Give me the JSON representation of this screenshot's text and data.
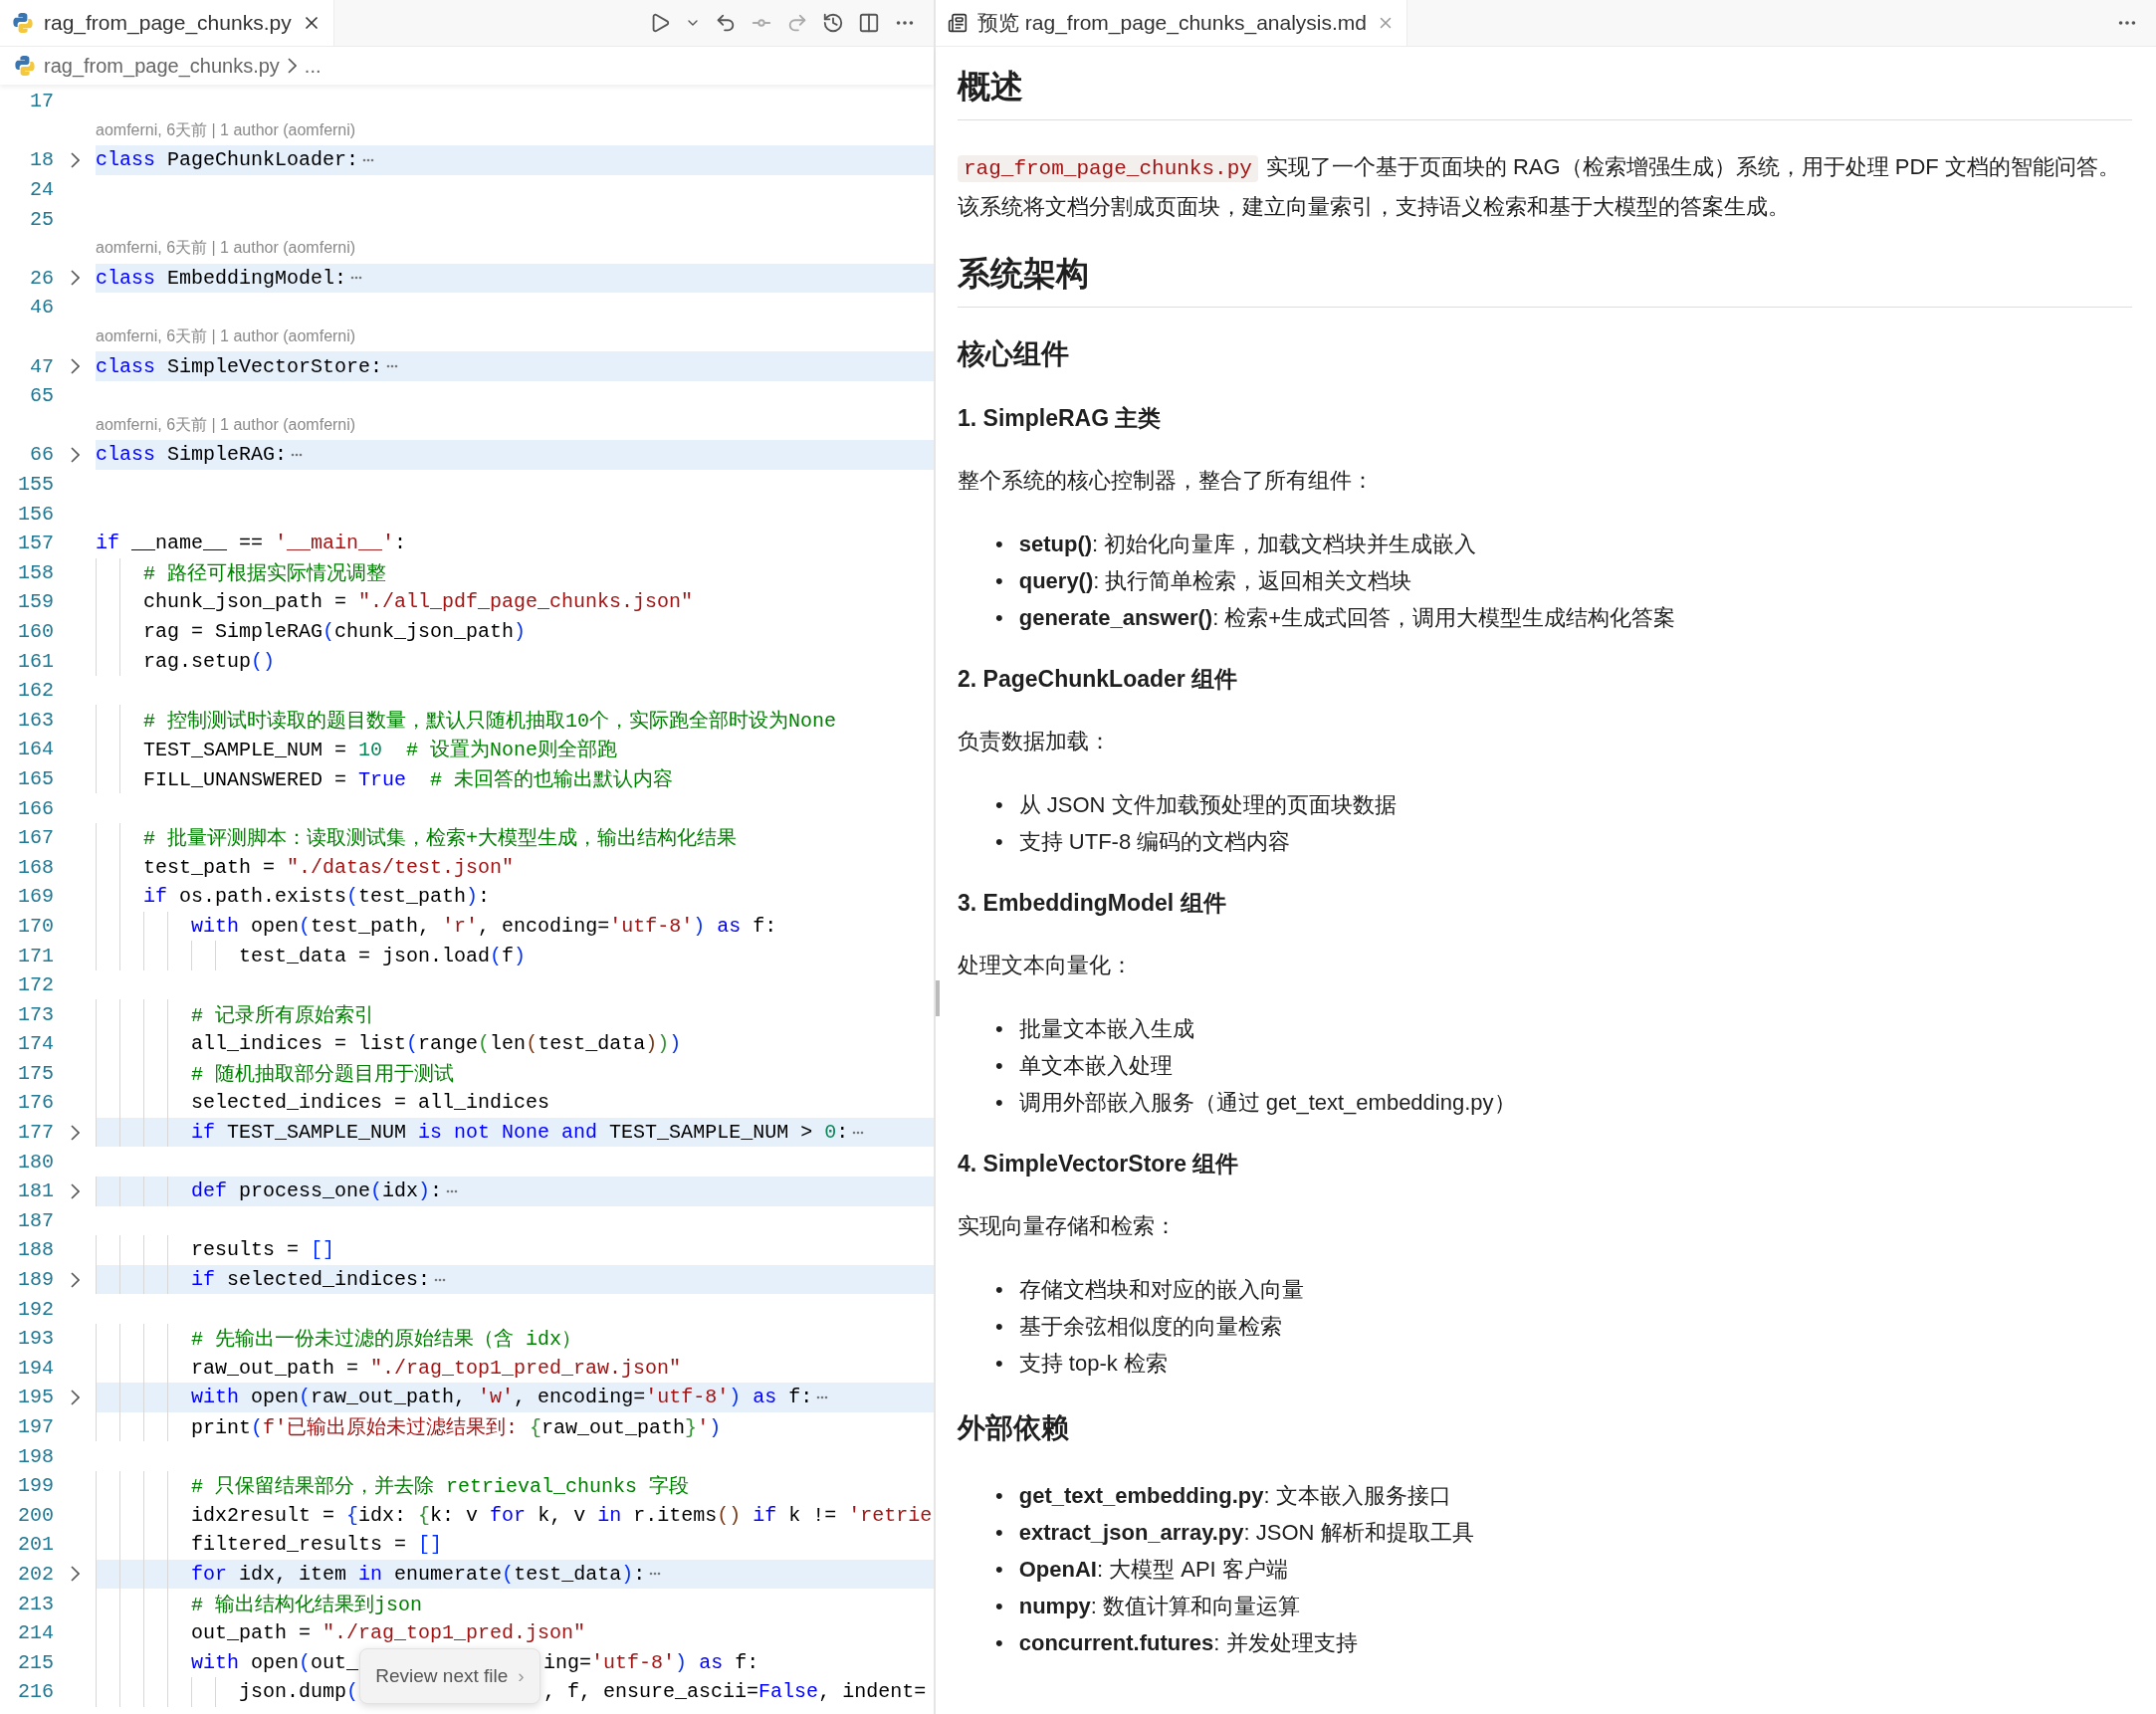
{
  "editor": {
    "tab": {
      "label": "rag_from_page_chunks.py",
      "selected": true
    },
    "breadcrumb": [
      "rag_from_page_chunks.py",
      "..."
    ],
    "lines": [
      {
        "number": "17"
      },
      {
        "kind": "blame",
        "text": "aomferni, 6天前 | 1 author (aomferni)"
      },
      {
        "number": "18",
        "folded": true,
        "code": [
          {
            "kind": "kw",
            "text": "class"
          },
          {
            "kind": "plain",
            "text": " PageChunkLoader:"
          }
        ]
      },
      {
        "number": "24"
      },
      {
        "number": "25"
      },
      {
        "kind": "blame",
        "text": "aomferni, 6天前 | 1 author (aomferni)"
      },
      {
        "number": "26",
        "folded": true,
        "code": [
          {
            "kind": "kw",
            "text": "class"
          },
          {
            "kind": "plain",
            "text": " EmbeddingModel:"
          }
        ]
      },
      {
        "number": "46"
      },
      {
        "kind": "blame",
        "text": "aomferni, 6天前 | 1 author (aomferni)"
      },
      {
        "number": "47",
        "folded": true,
        "code": [
          {
            "kind": "kw",
            "text": "class"
          },
          {
            "kind": "plain",
            "text": " SimpleVectorStore:"
          }
        ]
      },
      {
        "number": "65"
      },
      {
        "kind": "blame",
        "text": "aomferni, 6天前 | 1 author (aomferni)"
      },
      {
        "number": "66",
        "folded": true,
        "code": [
          {
            "kind": "kw",
            "text": "class"
          },
          {
            "kind": "plain",
            "text": " SimpleRAG:"
          }
        ]
      },
      {
        "number": "155"
      },
      {
        "number": "156"
      },
      {
        "number": "157",
        "code": [
          {
            "kind": "kw",
            "text": "if"
          },
          {
            "kind": "plain",
            "text": " __name__ == "
          },
          {
            "kind": "str",
            "text": "'__main__'"
          },
          {
            "kind": "plain",
            "text": ":"
          }
        ]
      },
      {
        "number": "158",
        "code": [
          {
            "kind": "cmt",
            "text": "    # 路径可根据实际情况调整"
          }
        ]
      },
      {
        "number": "159",
        "code": [
          {
            "kind": "plain",
            "text": "    chunk_json_path = "
          },
          {
            "kind": "str",
            "text": "\"./all_pdf_page_chunks.json\""
          }
        ]
      },
      {
        "number": "160",
        "code": [
          {
            "kind": "plain",
            "text": "    rag = SimpleRAG"
          },
          {
            "kind": "p1",
            "text": "("
          },
          {
            "kind": "plain",
            "text": "chunk_json_path"
          },
          {
            "kind": "p1",
            "text": ")"
          }
        ]
      },
      {
        "number": "161",
        "code": [
          {
            "kind": "plain",
            "text": "    rag.setup"
          },
          {
            "kind": "p1",
            "text": "()"
          }
        ]
      },
      {
        "number": "162"
      },
      {
        "number": "163",
        "code": [
          {
            "kind": "cmt",
            "text": "    # 控制测试时读取的题目数量，默认只随机抽取10个，实际跑全部时设为None"
          }
        ]
      },
      {
        "number": "164",
        "code": [
          {
            "kind": "plain",
            "text": "    TEST_SAMPLE_NUM = "
          },
          {
            "kind": "num",
            "text": "10"
          },
          {
            "kind": "cmt",
            "text": "  # 设置为None则全部跑"
          }
        ]
      },
      {
        "number": "165",
        "code": [
          {
            "kind": "plain",
            "text": "    FILL_UNANSWERED = "
          },
          {
            "kind": "kw",
            "text": "True"
          },
          {
            "kind": "cmt",
            "text": "  # 未回答的也输出默认内容"
          }
        ]
      },
      {
        "number": "166"
      },
      {
        "number": "167",
        "code": [
          {
            "kind": "cmt",
            "text": "    # 批量评测脚本：读取测试集，检索+大模型生成，输出结构化结果"
          }
        ]
      },
      {
        "number": "168",
        "code": [
          {
            "kind": "plain",
            "text": "    test_path = "
          },
          {
            "kind": "str",
            "text": "\"./datas/test.json\""
          }
        ]
      },
      {
        "number": "169",
        "code": [
          {
            "kind": "kw",
            "text": "    if"
          },
          {
            "kind": "plain",
            "text": " os.path.exists"
          },
          {
            "kind": "p1",
            "text": "("
          },
          {
            "kind": "plain",
            "text": "test_path"
          },
          {
            "kind": "p1",
            "text": ")"
          },
          {
            "kind": "plain",
            "text": ":"
          }
        ]
      },
      {
        "number": "170",
        "code": [
          {
            "kind": "kw",
            "text": "        with"
          },
          {
            "kind": "plain",
            "text": " open"
          },
          {
            "kind": "p1",
            "text": "("
          },
          {
            "kind": "plain",
            "text": "test_path, "
          },
          {
            "kind": "str",
            "text": "'r'"
          },
          {
            "kind": "plain",
            "text": ", encoding="
          },
          {
            "kind": "str",
            "text": "'utf-8'"
          },
          {
            "kind": "p1",
            "text": ")"
          },
          {
            "kind": "kw",
            "text": " as"
          },
          {
            "kind": "plain",
            "text": " f:"
          }
        ]
      },
      {
        "number": "171",
        "code": [
          {
            "kind": "plain",
            "text": "            test_data = json.load"
          },
          {
            "kind": "p1",
            "text": "("
          },
          {
            "kind": "plain",
            "text": "f"
          },
          {
            "kind": "p1",
            "text": ")"
          }
        ]
      },
      {
        "number": "172"
      },
      {
        "number": "173",
        "code": [
          {
            "kind": "cmt",
            "text": "        # 记录所有原始索引"
          }
        ]
      },
      {
        "number": "174",
        "code": [
          {
            "kind": "plain",
            "text": "        all_indices = list"
          },
          {
            "kind": "p1",
            "text": "("
          },
          {
            "kind": "plain",
            "text": "range"
          },
          {
            "kind": "p2",
            "text": "("
          },
          {
            "kind": "plain",
            "text": "len"
          },
          {
            "kind": "p3",
            "text": "("
          },
          {
            "kind": "plain",
            "text": "test_data"
          },
          {
            "kind": "p3",
            "text": ")"
          },
          {
            "kind": "p2",
            "text": ")"
          },
          {
            "kind": "p1",
            "text": ")"
          }
        ]
      },
      {
        "number": "175",
        "code": [
          {
            "kind": "cmt",
            "text": "        # 随机抽取部分题目用于测试"
          }
        ]
      },
      {
        "number": "176",
        "code": [
          {
            "kind": "plain",
            "text": "        selected_indices = all_indices"
          }
        ]
      },
      {
        "number": "177",
        "folded": true,
        "code": [
          {
            "kind": "kw",
            "text": "        if"
          },
          {
            "kind": "plain",
            "text": " TEST_SAMPLE_NUM "
          },
          {
            "kind": "kw",
            "text": "is not None and"
          },
          {
            "kind": "plain",
            "text": " TEST_SAMPLE_NUM > "
          },
          {
            "kind": "num",
            "text": "0"
          },
          {
            "kind": "plain",
            "text": ":"
          }
        ]
      },
      {
        "number": "180"
      },
      {
        "number": "181",
        "folded": true,
        "code": [
          {
            "kind": "kw",
            "text": "        def"
          },
          {
            "kind": "plain",
            "text": " process_one"
          },
          {
            "kind": "p1",
            "text": "("
          },
          {
            "kind": "plain",
            "text": "idx"
          },
          {
            "kind": "p1",
            "text": ")"
          },
          {
            "kind": "plain",
            "text": ":"
          }
        ]
      },
      {
        "number": "187"
      },
      {
        "number": "188",
        "code": [
          {
            "kind": "plain",
            "text": "        results = "
          },
          {
            "kind": "p1",
            "text": "[]"
          }
        ]
      },
      {
        "number": "189",
        "folded": true,
        "code": [
          {
            "kind": "kw",
            "text": "        if"
          },
          {
            "kind": "plain",
            "text": " selected_indices:"
          }
        ]
      },
      {
        "number": "192"
      },
      {
        "number": "193",
        "code": [
          {
            "kind": "cmt",
            "text": "        # 先输出一份未过滤的原始结果（含 idx）"
          }
        ]
      },
      {
        "number": "194",
        "code": [
          {
            "kind": "plain",
            "text": "        raw_out_path = "
          },
          {
            "kind": "str",
            "text": "\"./rag_top1_pred_raw.json\""
          }
        ]
      },
      {
        "number": "195",
        "folded": true,
        "code": [
          {
            "kind": "kw",
            "text": "        with"
          },
          {
            "kind": "plain",
            "text": " open"
          },
          {
            "kind": "p1",
            "text": "("
          },
          {
            "kind": "plain",
            "text": "raw_out_path, "
          },
          {
            "kind": "str",
            "text": "'w'"
          },
          {
            "kind": "plain",
            "text": ", encoding="
          },
          {
            "kind": "str",
            "text": "'utf-8'"
          },
          {
            "kind": "p1",
            "text": ")"
          },
          {
            "kind": "kw",
            "text": " as"
          },
          {
            "kind": "plain",
            "text": " f:"
          }
        ]
      },
      {
        "number": "197",
        "code": [
          {
            "kind": "plain",
            "text": "        print"
          },
          {
            "kind": "p1",
            "text": "("
          },
          {
            "kind": "str",
            "text": "f'已输出原始未过滤结果到: "
          },
          {
            "kind": "p2",
            "text": "{"
          },
          {
            "kind": "plain",
            "text": "raw_out_path"
          },
          {
            "kind": "p2",
            "text": "}"
          },
          {
            "kind": "str",
            "text": "'"
          },
          {
            "kind": "p1",
            "text": ")"
          }
        ]
      },
      {
        "number": "198"
      },
      {
        "number": "199",
        "code": [
          {
            "kind": "cmt",
            "text": "        # 只保留结果部分，并去除 retrieval_chunks 字段"
          }
        ]
      },
      {
        "number": "200",
        "code": [
          {
            "kind": "plain",
            "text": "        idx2result = "
          },
          {
            "kind": "p1",
            "text": "{"
          },
          {
            "kind": "plain",
            "text": "idx: "
          },
          {
            "kind": "p2",
            "text": "{"
          },
          {
            "kind": "plain",
            "text": "k: v "
          },
          {
            "kind": "kw",
            "text": "for"
          },
          {
            "kind": "plain",
            "text": " k, v "
          },
          {
            "kind": "kw",
            "text": "in"
          },
          {
            "kind": "plain",
            "text": " r.items"
          },
          {
            "kind": "p3",
            "text": "()"
          },
          {
            "kind": "kw",
            "text": " if"
          },
          {
            "kind": "plain",
            "text": " k != "
          },
          {
            "kind": "str",
            "text": "'retrie"
          }
        ]
      },
      {
        "number": "201",
        "code": [
          {
            "kind": "plain",
            "text": "        filtered_results = "
          },
          {
            "kind": "p1",
            "text": "[]"
          }
        ]
      },
      {
        "number": "202",
        "folded": true,
        "code": [
          {
            "kind": "kw",
            "text": "        for"
          },
          {
            "kind": "plain",
            "text": " idx, item "
          },
          {
            "kind": "kw",
            "text": "in"
          },
          {
            "kind": "plain",
            "text": " enumerate"
          },
          {
            "kind": "p1",
            "text": "("
          },
          {
            "kind": "plain",
            "text": "test_data"
          },
          {
            "kind": "p1",
            "text": ")"
          },
          {
            "kind": "plain",
            "text": ":"
          }
        ]
      },
      {
        "number": "213",
        "code": [
          {
            "kind": "cmt",
            "text": "        # 输出结构化结果到json"
          }
        ]
      },
      {
        "number": "214",
        "code": [
          {
            "kind": "plain",
            "text": "        out_path = "
          },
          {
            "kind": "str",
            "text": "\"./rag_top1_pred.json\""
          }
        ]
      },
      {
        "number": "215",
        "code": [
          {
            "kind": "kw",
            "text": "        with"
          },
          {
            "kind": "plain",
            "text": " open"
          },
          {
            "kind": "p1",
            "text": "("
          },
          {
            "kind": "plain",
            "text": "out_"
          },
          {
            "kind": "gap"
          },
          {
            "kind": "plain",
            "text": "ing="
          },
          {
            "kind": "str",
            "text": "'utf-8'"
          },
          {
            "kind": "p1",
            "text": ")"
          },
          {
            "kind": "kw",
            "text": " as"
          },
          {
            "kind": "plain",
            "text": " f:"
          }
        ]
      },
      {
        "number": "216",
        "code": [
          {
            "kind": "plain",
            "text": "            json.dump"
          },
          {
            "kind": "p1",
            "text": "("
          },
          {
            "kind": "gap"
          },
          {
            "kind": "plain",
            "text": ", f, ensure_ascii="
          },
          {
            "kind": "kw",
            "text": "False"
          },
          {
            "kind": "plain",
            "text": ", indent="
          }
        ]
      }
    ],
    "review_popup": {
      "label": "Review next file",
      "icon": "›"
    }
  },
  "preview": {
    "tab": {
      "label": "预览 rag_from_page_chunks_analysis.md",
      "selected": true
    },
    "blocks": [
      {
        "kind": "h1",
        "text": "概述"
      },
      {
        "kind": "p",
        "code": "rag_from_page_chunks.py",
        "text": "实现了一个基于页面块的 RAG（检索增强生成）系统，用于处理 PDF 文档的智能问答。该系统将文档分割成页面块，建立向量索引，支持语义检索和基于大模型的答案生成。"
      },
      {
        "kind": "h1",
        "text": "系统架构"
      },
      {
        "kind": "h2",
        "text": "核心组件"
      },
      {
        "kind": "h3",
        "text": "1. SimpleRAG 主类"
      },
      {
        "kind": "p",
        "text": "整个系统的核心控制器，整合了所有组件："
      },
      {
        "kind": "ul",
        "marker": "•",
        "items": [
          "**setup()**: 初始化向量库，加载文档块并生成嵌入",
          "**query()**: 执行简单检索，返回相关文档块",
          "**generate_answer()**: 检索+生成式回答，调用大模型生成结构化答案"
        ]
      },
      {
        "kind": "h3",
        "text": "2. PageChunkLoader 组件"
      },
      {
        "kind": "p",
        "text": "负责数据加载："
      },
      {
        "kind": "ul",
        "marker": "•",
        "items": [
          "从 JSON 文件加载预处理的页面块数据",
          "支持 UTF-8 编码的文档内容"
        ]
      },
      {
        "kind": "h3",
        "text": "3. EmbeddingModel 组件"
      },
      {
        "kind": "p",
        "text": "处理文本向量化："
      },
      {
        "kind": "ul",
        "marker": "•",
        "items": [
          "批量文本嵌入生成",
          "单文本嵌入处理",
          "调用外部嵌入服务（通过 get_text_embedding.py）"
        ]
      },
      {
        "kind": "h3",
        "text": "4. SimpleVectorStore 组件"
      },
      {
        "kind": "p",
        "text": "实现向量存储和检索："
      },
      {
        "kind": "ul",
        "marker": "•",
        "items": [
          "存储文档块和对应的嵌入向量",
          "基于余弦相似度的向量检索",
          "支持 top-k 检索"
        ]
      },
      {
        "kind": "h2",
        "text": "外部依赖"
      },
      {
        "kind": "ul",
        "marker": "•",
        "items": [
          "**get_text_embedding.py**: 文本嵌入服务接口",
          "**extract_json_array.py**: JSON 解析和提取工具",
          "**OpenAI**: 大模型 API 客户端",
          "**numpy**: 数值计算和向量运算",
          "**concurrent.futures**: 并发处理支持"
        ]
      }
    ]
  }
}
